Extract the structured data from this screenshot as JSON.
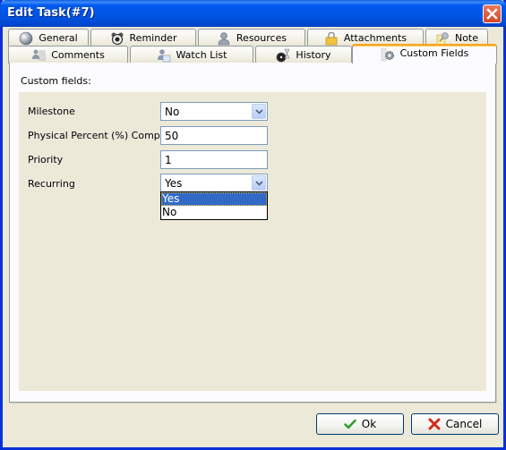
{
  "window": {
    "title": "Edit Task(#7)",
    "close_icon": "close-icon"
  },
  "tabs": {
    "row1": [
      {
        "label": "General",
        "icon": "sphere-icon"
      },
      {
        "label": "Reminder",
        "icon": "alarm-clock-icon"
      },
      {
        "label": "Resources",
        "icon": "user-icon"
      },
      {
        "label": "Attachments",
        "icon": "lock-folder-icon"
      },
      {
        "label": "Note",
        "icon": "pin-note-icon"
      }
    ],
    "row2": [
      {
        "label": "Comments",
        "icon": "comments-icon"
      },
      {
        "label": "Watch List",
        "icon": "watch-list-icon"
      },
      {
        "label": "History",
        "icon": "history-icon"
      },
      {
        "label": "Custom Fields",
        "icon": "gear-icon",
        "active": true
      }
    ]
  },
  "panel": {
    "section_label": "Custom fields:",
    "fields": [
      {
        "label": "Milestone",
        "type": "combo",
        "value": "No"
      },
      {
        "label": "Physical Percent (%) Complete",
        "type": "text",
        "value": "50"
      },
      {
        "label": "Priority",
        "type": "text",
        "value": "1"
      },
      {
        "label": "Recurring",
        "type": "combo",
        "value": "Yes",
        "open": true,
        "options": [
          "Yes",
          "No"
        ],
        "highlighted": "Yes"
      }
    ]
  },
  "buttons": {
    "ok": "Ok",
    "cancel": "Cancel"
  }
}
